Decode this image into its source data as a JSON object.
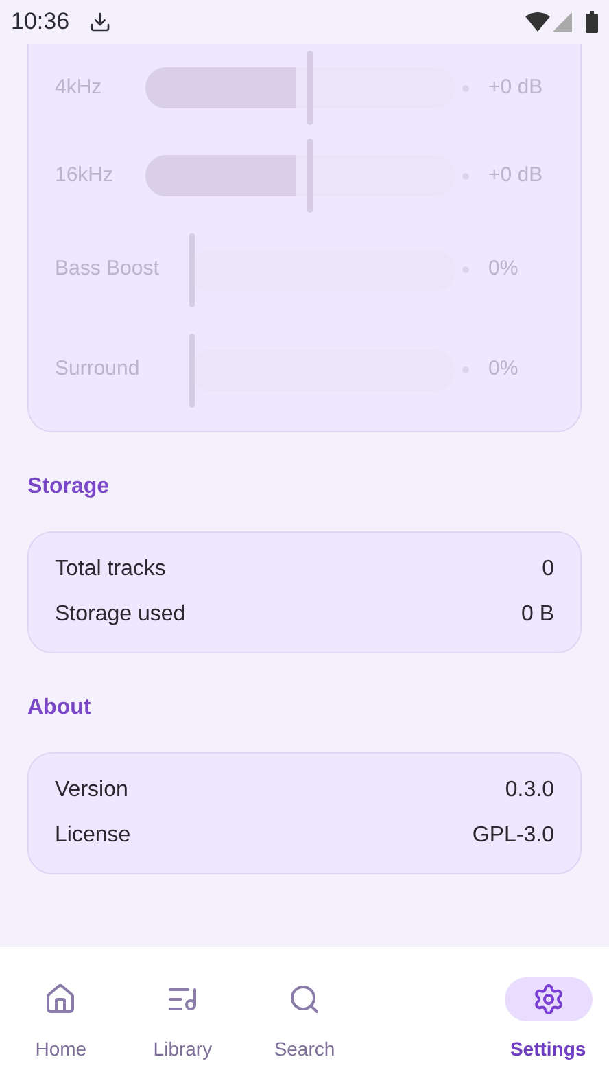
{
  "status_bar": {
    "time": "10:36"
  },
  "equalizer": {
    "rows": [
      {
        "kind": "band",
        "label": "4kHz",
        "level": 0.5,
        "reading": "+0 dB"
      },
      {
        "kind": "band",
        "label": "16kHz",
        "level": 0.5,
        "reading": "+0 dB"
      },
      {
        "kind": "effect",
        "label": "Bass Boost",
        "level": 0,
        "reading": "0%"
      },
      {
        "kind": "effect",
        "label": "Surround",
        "level": 0,
        "reading": "0%"
      }
    ]
  },
  "sections": [
    {
      "title": "Storage",
      "rows": [
        {
          "label": "Total tracks",
          "value": "0"
        },
        {
          "label": "Storage used",
          "value": "0 B"
        }
      ]
    },
    {
      "title": "About",
      "rows": [
        {
          "label": "Version",
          "value": "0.3.0"
        },
        {
          "label": "License",
          "value": "GPL-3.0"
        }
      ]
    }
  ],
  "nav": [
    {
      "kind": "home",
      "label": "Home",
      "selected": false
    },
    {
      "kind": "library",
      "label": "Library",
      "selected": false
    },
    {
      "kind": "search",
      "label": "Search",
      "selected": false
    },
    {
      "kind": "blank"
    },
    {
      "kind": "settings",
      "label": "Settings",
      "selected": true
    }
  ]
}
